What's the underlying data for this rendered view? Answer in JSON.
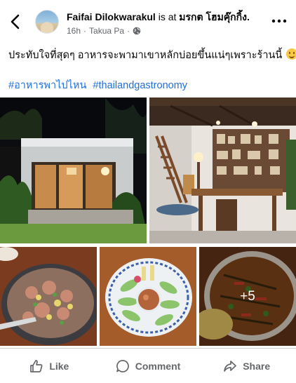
{
  "post": {
    "author": "Faifai Dilokwarakul",
    "is_at": "is at",
    "place": "มรกต โฮมคุ๊กกิ้ง.",
    "time": "16h",
    "separator": "·",
    "location": "Takua Pa",
    "privacy_icon": "globe-icon",
    "caption": "ประทับใจที่สุดๆ อาหารจะพามาเขาหลักบ่อยขึ้นแน่ๆเพราะร้านนี้",
    "hashtags": [
      "#อาหารพาไปไหน",
      "#thailandgastronomy"
    ],
    "more_photos_label": "+5"
  },
  "actions": {
    "like": "Like",
    "comment": "Comment",
    "share": "Share"
  },
  "colors": {
    "link": "#216fdb",
    "secondary_text": "#65676b",
    "divider": "#ced0d4"
  }
}
